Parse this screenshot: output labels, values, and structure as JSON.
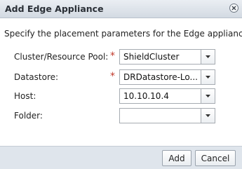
{
  "dialog": {
    "title": "Add Edge Appliance",
    "instruction": "Specify the placement parameters for the Edge appliance."
  },
  "icons": {
    "close": "close-icon",
    "dropdown": "chevron-down-icon"
  },
  "fields": [
    {
      "label": "Cluster/Resource Pool:",
      "required": true,
      "value": "ShieldCluster"
    },
    {
      "label": "Datastore:",
      "required": true,
      "value": "DRDatastore-Lo..."
    },
    {
      "label": "Host:",
      "required": false,
      "value": "10.10.10.4"
    },
    {
      "label": "Folder:",
      "required": false,
      "value": ""
    }
  ],
  "required_marker": "*",
  "buttons": {
    "add": "Add",
    "cancel": "Cancel"
  },
  "colors": {
    "required": "#c0392b",
    "footer": "#dfe5ec",
    "titlebar": "#d3dae2"
  }
}
